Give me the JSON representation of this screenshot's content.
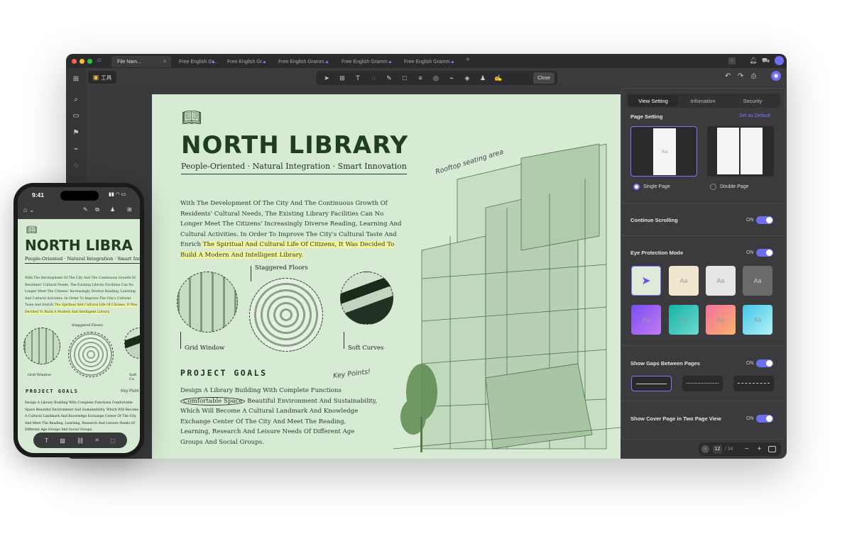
{
  "window": {
    "home_icon": "home-icon",
    "tabs": [
      {
        "label": "File Nam..."
      },
      {
        "label": "Free English Gr..."
      },
      {
        "label": "Free English Gr..."
      },
      {
        "label": "Free English Gramm..."
      },
      {
        "label": "Free English Gramm..."
      },
      {
        "label": "Free English Gramm..."
      }
    ],
    "new_tab": "+"
  },
  "toolbar": {
    "mode_label": "工具",
    "close_label": "Close"
  },
  "document": {
    "title": "NORTH LIBRARY",
    "subtitle": "People-Oriented · Natural Integration · Smart Innovation",
    "intro_plain": "With The Development Of The City And The Continuous Growth Of Residents' Cultural Needs, The Existing Library Facilities Can No Longer Meet The Citizens' Increasingly Diverse Reading, Learning And Cultural Activities. In Order To Improve The City's Cultural Taste And Enrich ",
    "intro_highlight": "The Spiritual And Cultural Life Of Citizens, It Was Decided To Build A Modern And Intelligent Library.",
    "annotation_rooftop": "Rooftop seating area",
    "labels": {
      "grid_window": "Grid Window",
      "staggered_floors": "Staggered Floors",
      "soft_curves": "Soft Curves"
    },
    "goals_heading": "PROJECT GOALS",
    "key_points": "Key Points!",
    "goals_before": "Design A Library Building With Complete Functions",
    "goals_circled": "Comfortable Space",
    "goals_after": " Beautiful Environment And Sustainability, Which Will Become A Cultural Landmark And Knowledge Exchange Center Of The City And Meet The Reading, Learning, Research And Leisure Needs Of Different Age Groups And Social Groups."
  },
  "panel": {
    "tabs": [
      "View Setting",
      "Infomation",
      "Security"
    ],
    "page_setting": "Page Setting",
    "set_default": "Set as Default",
    "single_page": "Single Page",
    "double_page": "Double Page",
    "continue_scrolling": "Continue Scrolling",
    "eye_protection": "Eye Protection Mode",
    "show_gaps": "Show Gaps Between Pages",
    "show_cover": "Show Cover Page in Two Page View",
    "on_label": "ON",
    "aa": "Aa"
  },
  "pager": {
    "current": "12",
    "total": "/ 34",
    "minus": "−",
    "plus": "+"
  },
  "phone": {
    "time": "9:41",
    "title": "NORTH LIBRA",
    "subtitle": "People-Oriented · Natural Integration · Smart Inno",
    "intro_plain": "With The Development Of The City And The Continuous Growth Of Residents' Cultural Needs, The Existing Library Facilities Can No Longer Meet The Citizens' Increasingly Diverse Reading, Learning And Cultural Activities. In Order To Improve The City's Cultural Taste And Enrich ",
    "intro_highlight": "The Spiritual And Cultural Life Of Citizens, It Was Decided To Build A Modern And Intelligent Library.",
    "staggered": "Staggered Floors",
    "grid_window": "Grid Window",
    "soft": "Soft Cu",
    "goals_heading": "PROJECT GOALS",
    "key_points": "Key Point",
    "goals_text": "Design A Library Building With Complete Functions Comfortable Space Beautiful Environment And Sustainability, Which Will Become A Cultural Landmark And Knowledge Exchange Center Of The City And Meet The Reading, Learning, Research And Leisure Needs Of Different Age Groups And Social Groups."
  },
  "colors": {
    "accent": "#6e6ef0",
    "page_bg": "#d7ebd4",
    "title_green": "#1f3d22",
    "highlight": "#f2f59a"
  }
}
